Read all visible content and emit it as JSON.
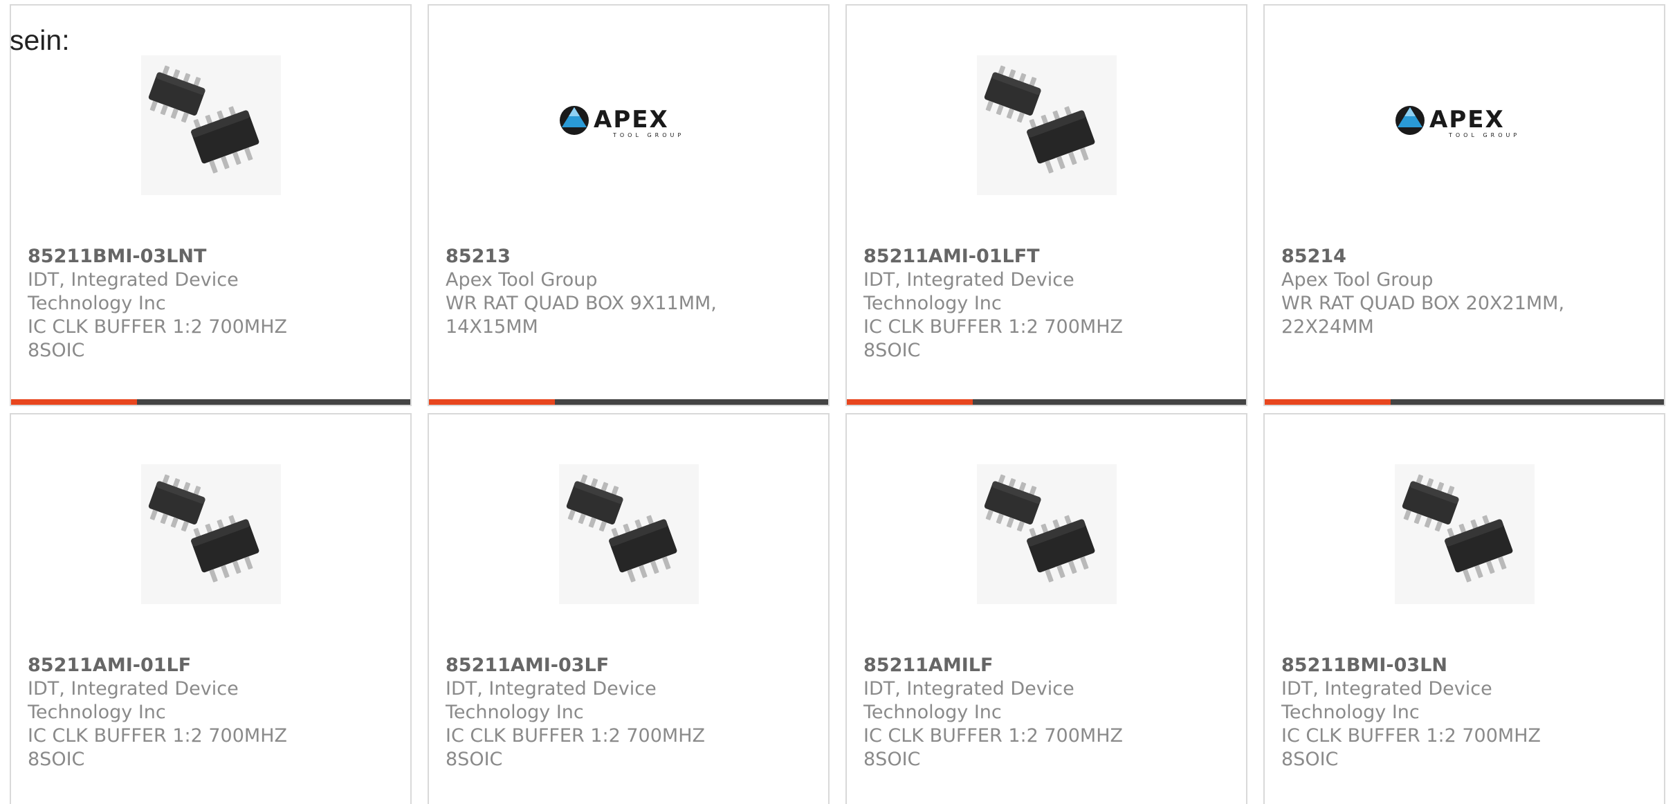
{
  "prefix_text": "sein:",
  "colors": {
    "accent": "#e8461e",
    "bar": "#444444",
    "border": "#d9d9d9",
    "apex_blue": "#2a9ad6"
  },
  "products": [
    {
      "part_number": "85211BMI-03LNT",
      "manufacturer": "IDT, Integrated Device Technology Inc",
      "description": "IC CLK BUFFER 1:2 700MHZ 8SOIC",
      "image": "chip-icon"
    },
    {
      "part_number": "85213",
      "manufacturer": "Apex Tool Group",
      "description": "WR RAT QUAD BOX 9X11MM, 14X15MM",
      "image": "apex-logo",
      "logo_text": "APEX",
      "logo_subtext": "TOOL GROUP"
    },
    {
      "part_number": "85211AMI-01LFT",
      "manufacturer": "IDT, Integrated Device Technology Inc",
      "description": "IC CLK BUFFER 1:2 700MHZ 8SOIC",
      "image": "chip-icon"
    },
    {
      "part_number": "85214",
      "manufacturer": "Apex Tool Group",
      "description": "WR RAT QUAD BOX 20X21MM, 22X24MM",
      "image": "apex-logo",
      "logo_text": "APEX",
      "logo_subtext": "TOOL GROUP"
    },
    {
      "part_number": "85211AMI-01LF",
      "manufacturer": "IDT, Integrated Device Technology Inc",
      "description": "IC CLK BUFFER 1:2 700MHZ 8SOIC",
      "image": "chip-icon"
    },
    {
      "part_number": "85211AMI-03LF",
      "manufacturer": "IDT, Integrated Device Technology Inc",
      "description": "IC CLK BUFFER 1:2 700MHZ 8SOIC",
      "image": "chip-icon"
    },
    {
      "part_number": "85211AMILF",
      "manufacturer": "IDT, Integrated Device Technology Inc",
      "description": "IC CLK BUFFER 1:2 700MHZ 8SOIC",
      "image": "chip-icon"
    },
    {
      "part_number": "85211BMI-03LN",
      "manufacturer": "IDT, Integrated Device Technology Inc",
      "description": "IC CLK BUFFER 1:2 700MHZ 8SOIC",
      "image": "chip-icon"
    }
  ]
}
